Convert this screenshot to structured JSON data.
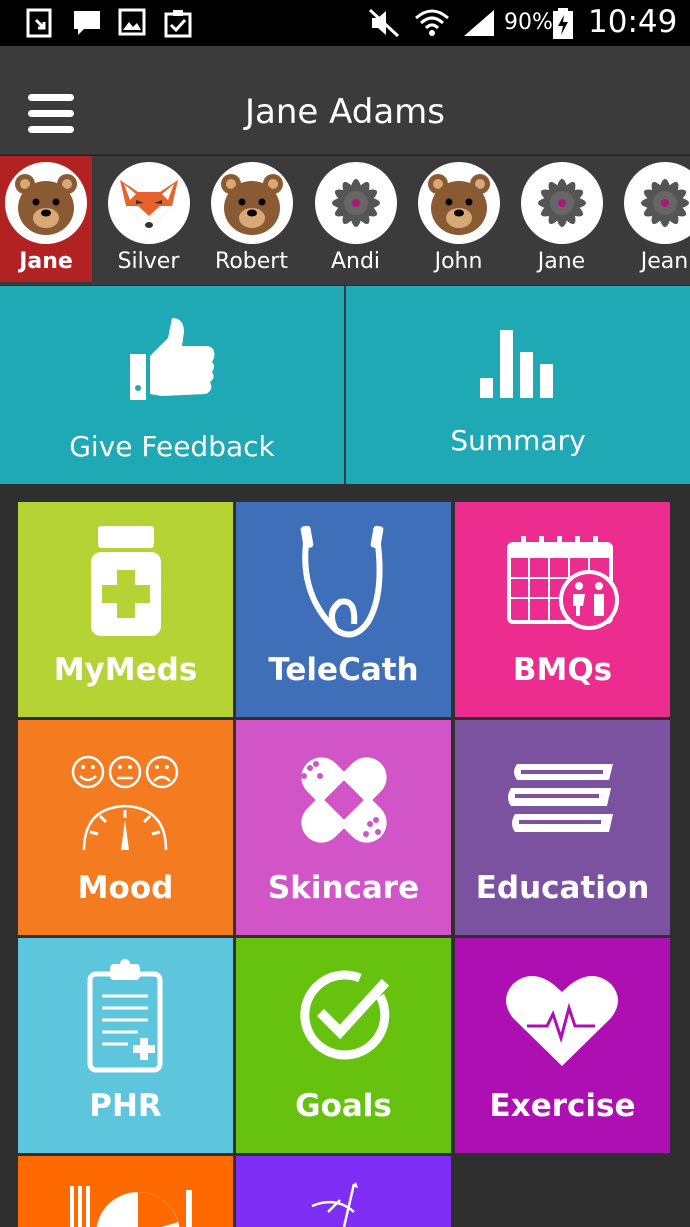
{
  "status_bar": {
    "battery": "90%",
    "time": "10:49"
  },
  "app_bar": {
    "title": "Jane Adams"
  },
  "profiles": [
    {
      "name": "Jane",
      "avatar": "bear-icon",
      "active": true
    },
    {
      "name": "Silver",
      "avatar": "fox-icon"
    },
    {
      "name": "Robert",
      "avatar": "bear-icon"
    },
    {
      "name": "Andi",
      "avatar": "flower-icon"
    },
    {
      "name": "John",
      "avatar": "bear-icon"
    },
    {
      "name": "Jane",
      "avatar": "flower-icon"
    },
    {
      "name": "Jean",
      "avatar": "flower-icon"
    }
  ],
  "actions": {
    "feedback": "Give Feedback",
    "summary": "Summary"
  },
  "tiles": [
    {
      "label": "MyMeds",
      "icon": "pill-bottle-icon",
      "color": "#b5d334"
    },
    {
      "label": "TeleCath",
      "icon": "catheter-icon",
      "color": "#3f6fb8"
    },
    {
      "label": "BMQs",
      "icon": "calendar-icon",
      "color": "#ec2c8f"
    },
    {
      "label": "Mood",
      "icon": "mood-gauge-icon",
      "color": "#f47b20"
    },
    {
      "label": "Skincare",
      "icon": "bandage-icon",
      "color": "#d155c6"
    },
    {
      "label": "Education",
      "icon": "books-icon",
      "color": "#7a52a0"
    },
    {
      "label": "PHR",
      "icon": "clipboard-icon",
      "color": "#5ec6dc"
    },
    {
      "label": "Goals",
      "icon": "checkmark-icon",
      "color": "#66c20f"
    },
    {
      "label": "Exercise",
      "icon": "heart-pulse-icon",
      "color": "#ad0fb3"
    },
    {
      "label": "",
      "icon": "nutrition-icon",
      "color": "#ff6a00"
    },
    {
      "label": "",
      "icon": "suture-icon",
      "color": "#7f2ff5"
    }
  ],
  "colors": {
    "teal": "#1fa9b4",
    "active_profile": "#b22222"
  }
}
